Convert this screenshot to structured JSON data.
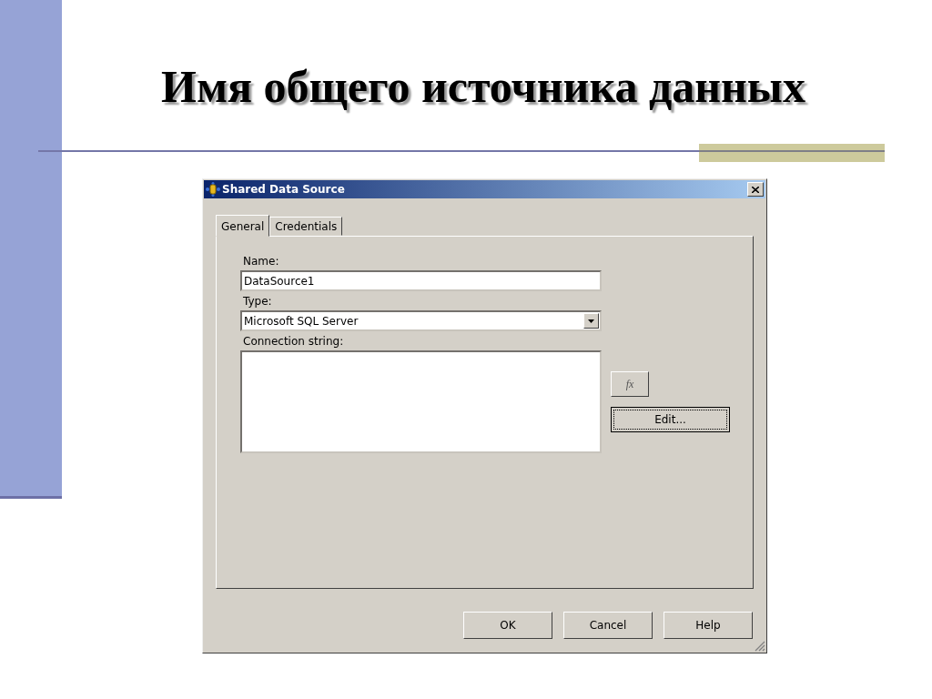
{
  "slide": {
    "title": "Имя общего источника данных"
  },
  "dialog": {
    "title": "Shared Data Source",
    "tabs": [
      {
        "label": "General",
        "selected": true
      },
      {
        "label": "Credentials",
        "selected": false
      }
    ],
    "name": {
      "label": "Name:",
      "value": "DataSource1"
    },
    "type": {
      "label": "Type:",
      "value": "Microsoft SQL Server"
    },
    "connection": {
      "label": "Connection string:",
      "expression_button": "fx",
      "edit_button": {
        "label": "Edit...",
        "focused": true
      }
    },
    "buttons": [
      {
        "label": "OK"
      },
      {
        "label": "Cancel"
      },
      {
        "label": "Help"
      }
    ]
  }
}
